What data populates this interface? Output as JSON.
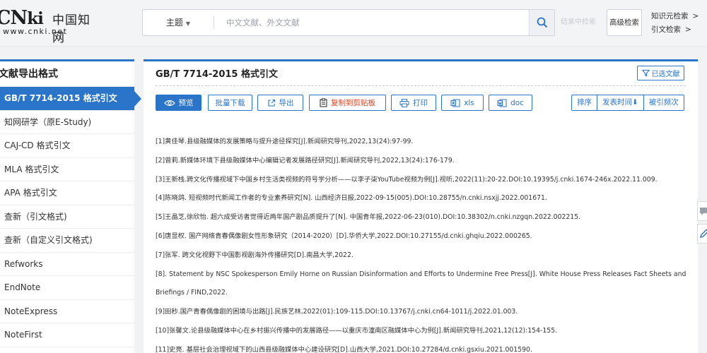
{
  "header": {
    "logo_mark_c": "C",
    "logo_mark_n": "N",
    "logo_mark_ki": "ki",
    "logo_cn": "中国知网",
    "logo_url": "www.cnki.net",
    "search_type": "主题",
    "search_placeholder": "中文文献、外文文献",
    "result_search_label": "结果中检索",
    "advanced_search_label": "高级检索",
    "knowledge_search_label": "知识元检索",
    "citation_search_label": "引文检索"
  },
  "sidebar": {
    "title": "文献导出格式",
    "items": [
      {
        "label": "GB/T 7714-2015 格式引文",
        "active": true
      },
      {
        "label": "知网研学（原E-Study)"
      },
      {
        "label": "CAJ-CD 格式引文"
      },
      {
        "label": "MLA 格式引文"
      },
      {
        "label": "APA 格式引文"
      },
      {
        "label": "查新（引文格式)"
      },
      {
        "label": "查新（自定义引文格式)"
      },
      {
        "label": "Refworks"
      },
      {
        "label": "EndNote"
      },
      {
        "label": "NoteExpress"
      },
      {
        "label": "NoteFirst"
      }
    ]
  },
  "main": {
    "title": "GB/T 7714-2015 格式引文",
    "selected_label": "已选文献",
    "toolbar": {
      "preview": "预览",
      "batch_download": "批量下载",
      "export": "导出",
      "copy": "复制到剪贴板",
      "print": "打印",
      "xls": "xls",
      "doc": "doc"
    },
    "sort": {
      "label": "排序",
      "by_date": "发表时间",
      "by_date_arrow": "⬇",
      "by_cited": "被引频次"
    },
    "references": [
      "[1]黄佳琴.县级融媒体的发展策略与提升途径探究[J].新闻研究导刊,2022,13(24):97-99.",
      "[2]曾莉.新媒体环境下县级融媒体中心编辑记者发展路径研究[J].新闻研究导刊,2022,13(24):176-179.",
      "[3]王新栈.跨文化传播视域下中国乡村生活类视频的符号学分析——以李子柒YouTube视频为例[J].视听,2022(11):20-22.DOI:10.19395/j.cnki.1674-246x.2022.11.009.",
      "[4]陈晓鸽. 短视频时代新闻工作者的专业素养研究[N]. 山西经济日报,2022-09-15(005).DOI:10.28755/n.cnki.nsxjj.2022.001671.",
      "[5]王晶芝,徐欣怡. 超六成受访者觉得近两年国产剧品质提升了[N]. 中国青年报,2022-06-23(010).DOI:10.38302/n.cnki.nzgqn.2022.002215.",
      "[6]唐显权. 国产网络青春偶像剧女性形象研究（2014-2020）[D].华侨大学,2022.DOI:10.27155/d.cnki.ghqiu.2022.000265.",
      "[7]张军. 跨文化视野下中国影视剧海外传播研究[D].南昌大学,2022.",
      "[8]. Statement by NSC Spokesperson Emily Horne on Russian Disinformation and Efforts to Undermine Free Press[J]. White House Press Releases Fact Sheets and Briefings / FIND,2022.",
      "[9]田秒.国产青春偶像剧的困境与出路[J].民族艺林,2022(01):109-115.DOI:10.13767/j.cnki.cn64-1011/j.2022.01.003.",
      "[10]张馨文.论县级融媒体中心在乡村振兴传播中的发展路径——以重庆市潼南区融媒体中心为例[J].新闻研究导刊,2021,12(12):154-155.",
      "[11]史亮. 基层社会治理视域下的山西县级融媒体中心建设研究[D].山西大学,2021.DOI:10.27284/d.cnki.gsxiu.2021.001590."
    ]
  },
  "colors": {
    "accent": "#2a74c9",
    "copy_red": "#e0421e",
    "page_bg": "#f1f2f4"
  },
  "icons": [
    "search-icon",
    "filter-icon",
    "eye-icon",
    "export-icon",
    "clipboard-icon",
    "printer-icon",
    "excel-icon",
    "word-icon",
    "comment-icon",
    "edit-icon"
  ]
}
